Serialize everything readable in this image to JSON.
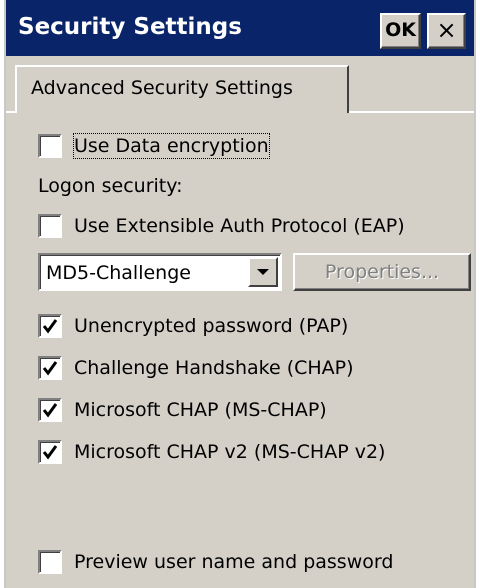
{
  "window": {
    "title": "Security Settings",
    "ok_label": "OK",
    "close_label": "×"
  },
  "tab": {
    "label": "Advanced Security Settings"
  },
  "options": {
    "data_encryption": {
      "label": "Use Data encryption",
      "checked": false
    },
    "logon_security_label": "Logon security:",
    "eap": {
      "label": "Use Extensible Auth Protocol (EAP)",
      "checked": false
    },
    "eap_type": {
      "value": "MD5-Challenge"
    },
    "properties_label": "Properties...",
    "pap": {
      "label": "Unencrypted password (PAP)",
      "checked": true
    },
    "chap": {
      "label": "Challenge Handshake  (CHAP)",
      "checked": true
    },
    "ms_chap": {
      "label": "Microsoft CHAP (MS-CHAP)",
      "checked": true
    },
    "ms_chap_v2": {
      "label": "Microsoft CHAP v2 (MS-CHAP v2)",
      "checked": true
    },
    "preview": {
      "label": "Preview user name and password",
      "checked": false
    }
  },
  "colors": {
    "titlebar": "#0a246a",
    "face": "#d4d0c8"
  }
}
